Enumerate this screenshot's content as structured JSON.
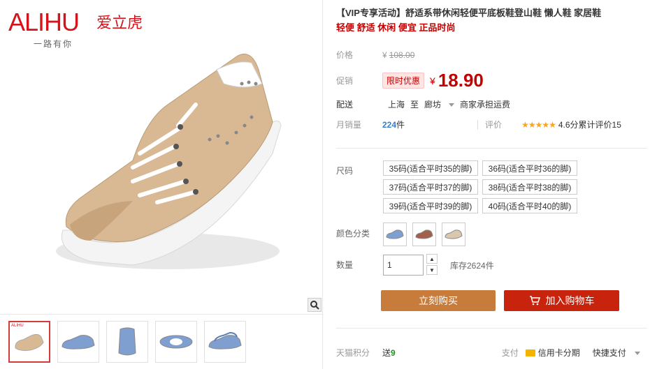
{
  "brand": {
    "en": "ALIHU",
    "cn": "爱立虎",
    "slogan": "一路有你"
  },
  "product": {
    "title": "【VIP专享活动】舒适系带休闲轻便平底板鞋登山鞋 懒人鞋 家居鞋",
    "subtitle": "轻便 舒适 休闲 便宜 正品时尚"
  },
  "price": {
    "label": "价格",
    "original": "108.00",
    "currency": "¥",
    "promo_label": "促销",
    "promo_tag": "限时优惠",
    "promo_price": "18.90"
  },
  "shipping": {
    "label": "配送",
    "from": "上海",
    "to_word": "至",
    "to": "廊坊",
    "note": "商家承担运费"
  },
  "sales": {
    "label": "月销量",
    "count": "224",
    "unit": "件",
    "review_label": "评价",
    "rating_text": "4.6分累计评价15",
    "rating": 4.6
  },
  "sku": {
    "size_label": "尺码",
    "sizes": [
      "35码(适合平时35的脚)",
      "36码(适合平时36的脚)",
      "37码(适合平时37的脚)",
      "38码(适合平时38的脚)",
      "39码(适合平时39的脚)",
      "40码(适合平时40的脚)"
    ],
    "color_label": "颜色分类",
    "colors": [
      "blue-shoe",
      "brown-shoe",
      "beige-shoe"
    ],
    "qty_label": "数量",
    "qty_value": "1",
    "stock": "库存2624件"
  },
  "actions": {
    "buy": "立刻购买",
    "cart": "加入购物车"
  },
  "footer": {
    "points_label": "天猫积分",
    "points_prefix": "送",
    "points": "9",
    "pay_label": "支付",
    "card": "信用卡分期",
    "quick": "快捷支付"
  },
  "colors": {
    "accent": "#c40000",
    "buy": "#c87c3c",
    "cart": "#c8240d",
    "brand": "#d6131b"
  }
}
